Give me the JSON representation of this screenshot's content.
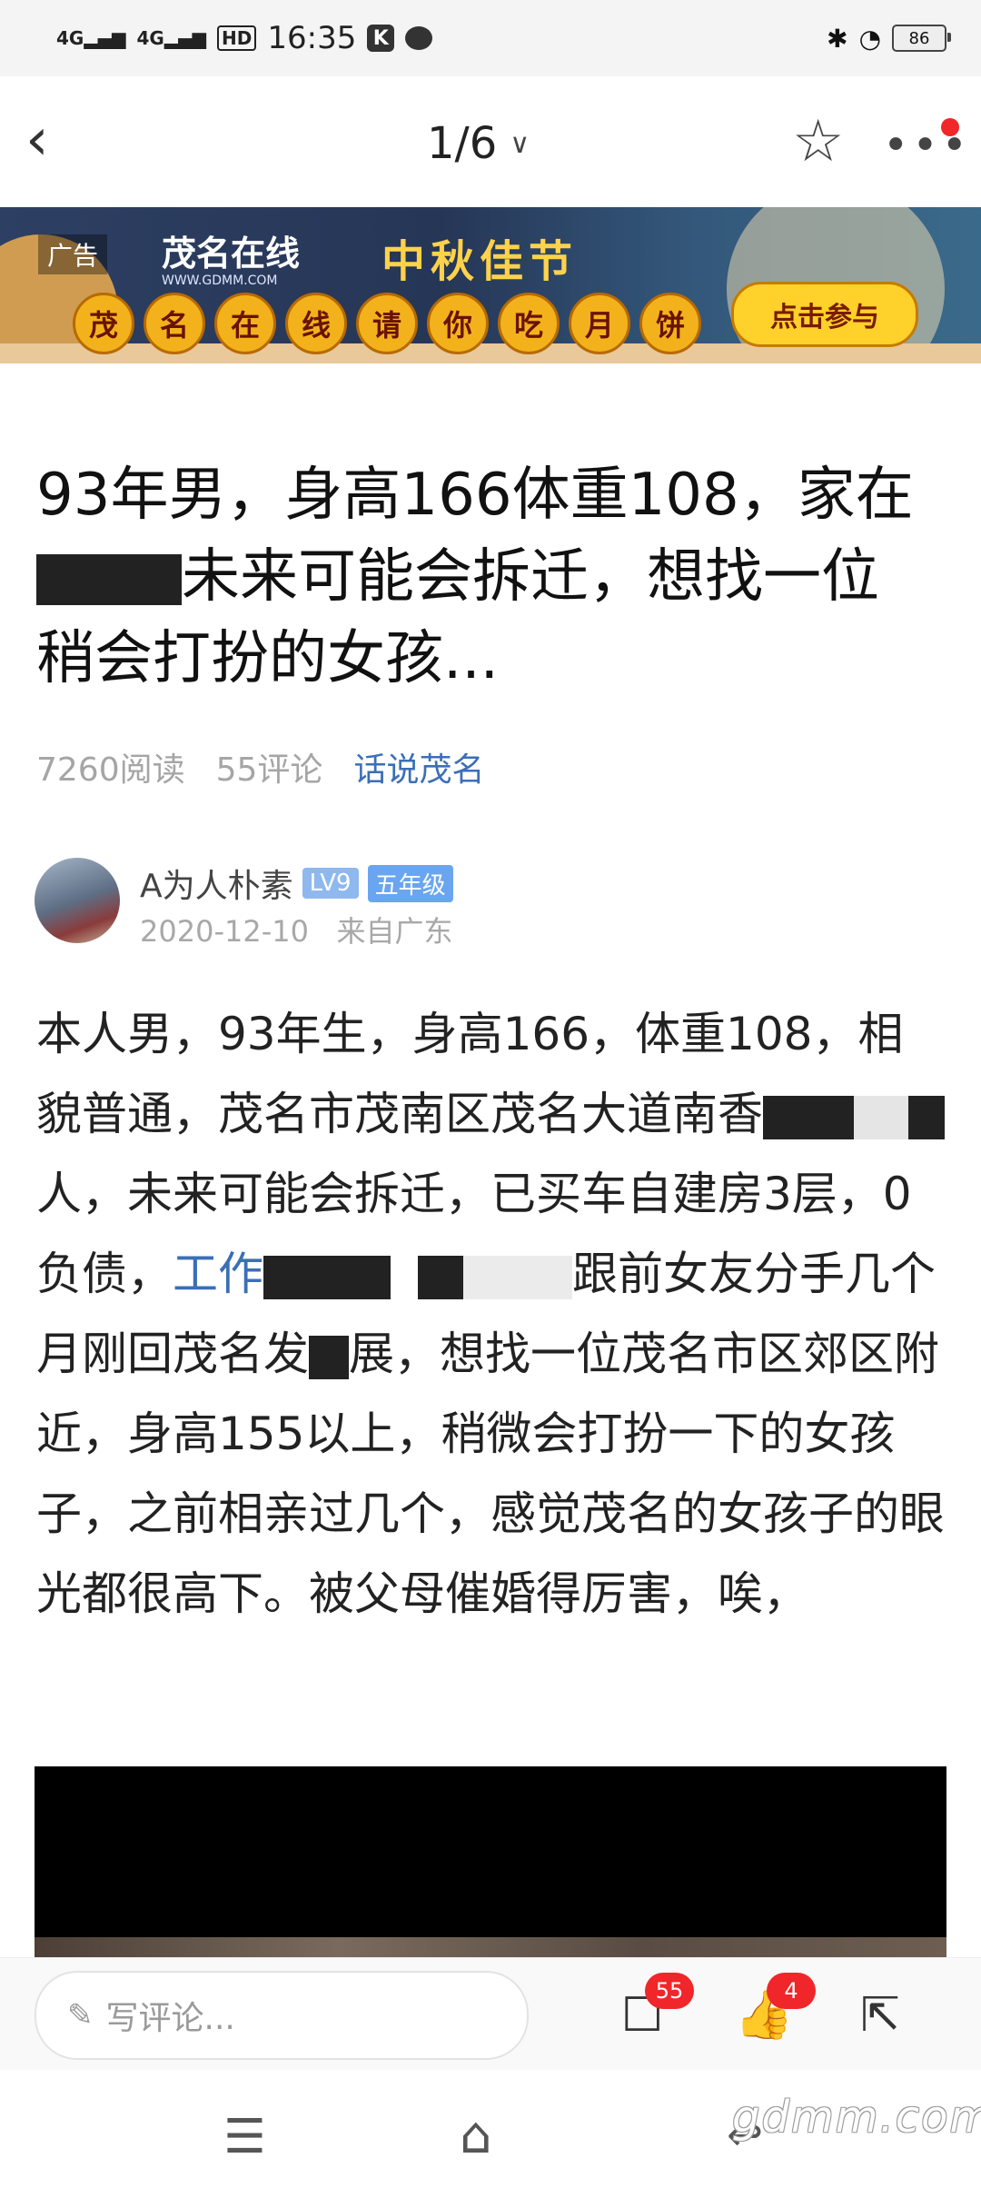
{
  "status_bar": {
    "network1": "4G",
    "network2": "4G",
    "hd": "HD",
    "time": "16:35",
    "app_icon": "K",
    "battery": "86"
  },
  "nav": {
    "page_indicator": "1/6"
  },
  "ad": {
    "label": "广告",
    "brand": "茂名在线",
    "brand_url": "WWW.GDMM.COM",
    "title": "中秋佳节",
    "circle_chars": [
      "茂",
      "名",
      "在",
      "线",
      "请",
      "你",
      "吃",
      "月",
      "饼"
    ],
    "cta": "点击参与"
  },
  "article": {
    "title_part1": "93年男，身高166体重108，家在",
    "title_part2": "未来可能会拆迁，想找一位稍会打扮的女孩...",
    "reads": "7260阅读",
    "comments": "55评论",
    "category": "话说茂名"
  },
  "author": {
    "name": "A为人朴素",
    "level": "LV9",
    "grade": "五年级",
    "date": "2020-12-10",
    "location": "来自广东"
  },
  "body": {
    "p1": "本人男，93年生，身高166，体重108，相貌普通，茂名市茂南区茂名大道南香",
    "p2": "人，未来可能会拆迁，已买车自建房3层，0负债，",
    "link": "工作",
    "p3": "跟前女友分手几个月刚回茂名发",
    "p4": "展，想找一位茂名市区郊区附近，身高155以上，稍微会打扮一下的女孩子，之前相亲过几个，感觉茂名的女孩子的眼光都很高下。被父母催婚得厉害，唉，"
  },
  "comment_bar": {
    "placeholder": "写评论...",
    "comment_count": "55",
    "like_count": "4"
  },
  "watermark": "gdmm.com",
  "icons": {
    "back": "back-arrow-icon",
    "star": "star-icon",
    "more": "more-icon",
    "pen": "pen-icon",
    "comment": "comment-icon",
    "like": "thumbs-up-icon",
    "share": "share-icon"
  }
}
